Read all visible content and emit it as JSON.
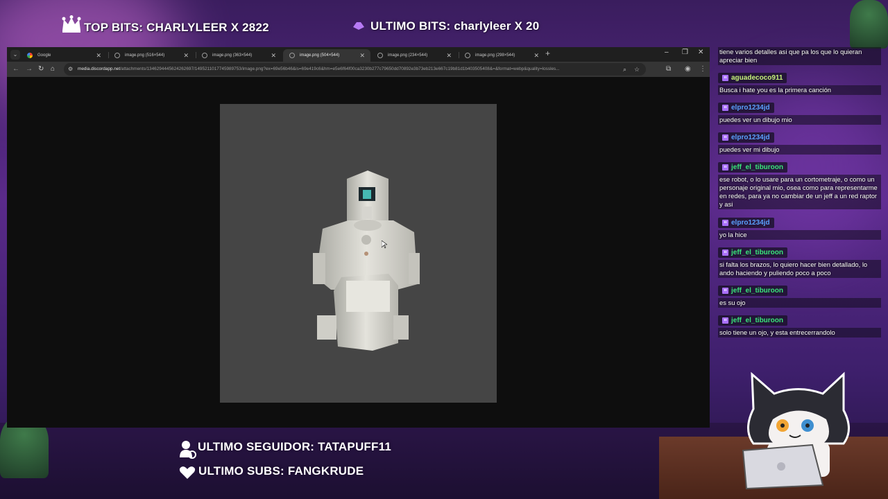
{
  "overlay": {
    "top_bits": "TOP BITS: CHARLYLEER X 2822",
    "ultimo_bits": "ULTIMO BITS: charlyleer X 20",
    "ultimo_seguidor": "ULTIMO SEGUIDOR: TATAPUFF11",
    "ultimo_subs": "ULTIMO SUBS: FANGKRUDE"
  },
  "browser": {
    "tabs": [
      {
        "label": "Google",
        "icon": "google-icon",
        "active": false
      },
      {
        "label": "image.png (516×544)",
        "icon": "globe-icon",
        "active": false
      },
      {
        "label": "image.png (363×544)",
        "icon": "globe-icon",
        "active": false
      },
      {
        "label": "image.png (504×544)",
        "icon": "globe-icon",
        "active": true
      },
      {
        "label": "image.png (234×544)",
        "icon": "globe-icon",
        "active": false
      },
      {
        "label": "image.png (298×544)",
        "icon": "globe-icon",
        "active": false
      }
    ],
    "url_host": "media.discordapp.net",
    "url_path": "/attachments/1346294445624262697/1495211017745989753/image.png?ex=69e56b46&is=69e419c6&hm=e5e6f64f00ca3230b277c79650dd70892e3b73eb213e667c19b81d1b403505408&=&format=webp&quality=lossles..."
  },
  "chat": {
    "messages": [
      {
        "user": "",
        "text": "tiene varios detalles asi que pa los que lo quieran apreciar bien",
        "color": "#ffffff"
      },
      {
        "user": "aguadecoco911",
        "text": "Busca i hate you es la primera canción",
        "color": "#c6f27a"
      },
      {
        "user": "elpro1234jd",
        "text": "puedes ver un dibujo mio",
        "color": "#5aa0ff"
      },
      {
        "user": "elpro1234jd",
        "text": "puedes ver mi dibujo",
        "color": "#5aa0ff"
      },
      {
        "user": "jeff_el_tiburoon",
        "text": "ese robot, o lo usare para un cortometraje, o como un personaje original mio, osea como para representarme en redes, para ya no cambiar de un jeff a un red raptor y asi",
        "color": "#39e57a"
      },
      {
        "user": "elpro1234jd",
        "text": "yo la hice",
        "color": "#5aa0ff"
      },
      {
        "user": "jeff_el_tiburoon",
        "text": "si falta los brazos, lo quiero hacer bien detallado, lo ando haciendo y puliendo poco a poco",
        "color": "#39e57a"
      },
      {
        "user": "jeff_el_tiburoon",
        "text": "es su ojo",
        "color": "#39e57a"
      },
      {
        "user": "jeff_el_tiburoon",
        "text": "solo tiene un ojo, y esta entrecerrandolo",
        "color": "#39e57a"
      }
    ]
  }
}
